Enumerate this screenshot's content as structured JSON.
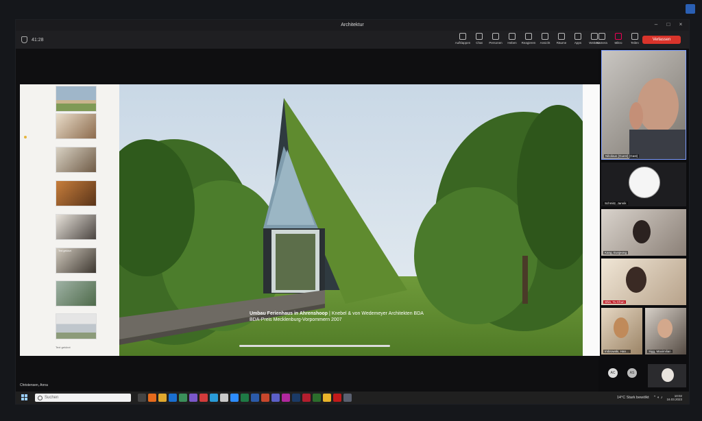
{
  "window": {
    "title": "Architektur"
  },
  "meeting": {
    "elapsed": "41:28"
  },
  "toolbar": {
    "items": [
      {
        "label": "Aufklappen",
        "icon": "expand-icon"
      },
      {
        "label": "Chat",
        "icon": "chat-icon"
      },
      {
        "label": "Personen",
        "icon": "people-icon"
      },
      {
        "label": "Heben",
        "icon": "hand-icon"
      },
      {
        "label": "Reagieren",
        "icon": "smile-icon"
      },
      {
        "label": "Ansicht",
        "icon": "grid-icon"
      },
      {
        "label": "Räume",
        "icon": "rooms-icon"
      },
      {
        "label": "Apps",
        "icon": "apps-icon"
      },
      {
        "label": "Weitere",
        "icon": "more-icon"
      }
    ],
    "media": [
      {
        "label": "Kamera",
        "icon": "camera-icon"
      },
      {
        "label": "Mikro",
        "icon": "mic-off-icon"
      },
      {
        "label": "Teilen",
        "icon": "share-icon"
      }
    ],
    "leave_label": "Verlassen"
  },
  "slide": {
    "caption_title": "Umbau Ferienhaus in Ahrenshoop",
    "caption_sep": " | ",
    "caption_authors": "Knebel & von Wedemeyer Architekten BDA",
    "caption_award": "BDA-Preis Mecklenburg-Vorpommern 2007",
    "thumb_caption": "Text gekürzt",
    "thumb_label_5": "Text gekürzt"
  },
  "participants": [
    {
      "name": "Nikolaus (Guest) (Gast)"
    },
    {
      "name": "Schmitz, Jannik"
    },
    {
      "name": "Kang, Eunjeong"
    },
    {
      "name": "Shin, Yu Chun"
    },
    {
      "name": "Imbrowski, Han…"
    },
    {
      "name": "Sigg, Maximilian"
    }
  ],
  "bottom": {
    "presenter": "Christensen, Anna",
    "avatars": [
      "AC",
      "AS"
    ]
  },
  "taskbar": {
    "search_placeholder": "Suchen",
    "weather": "14°C  Stark bewölkt",
    "time": "10:02",
    "date": "16.03.2023"
  }
}
